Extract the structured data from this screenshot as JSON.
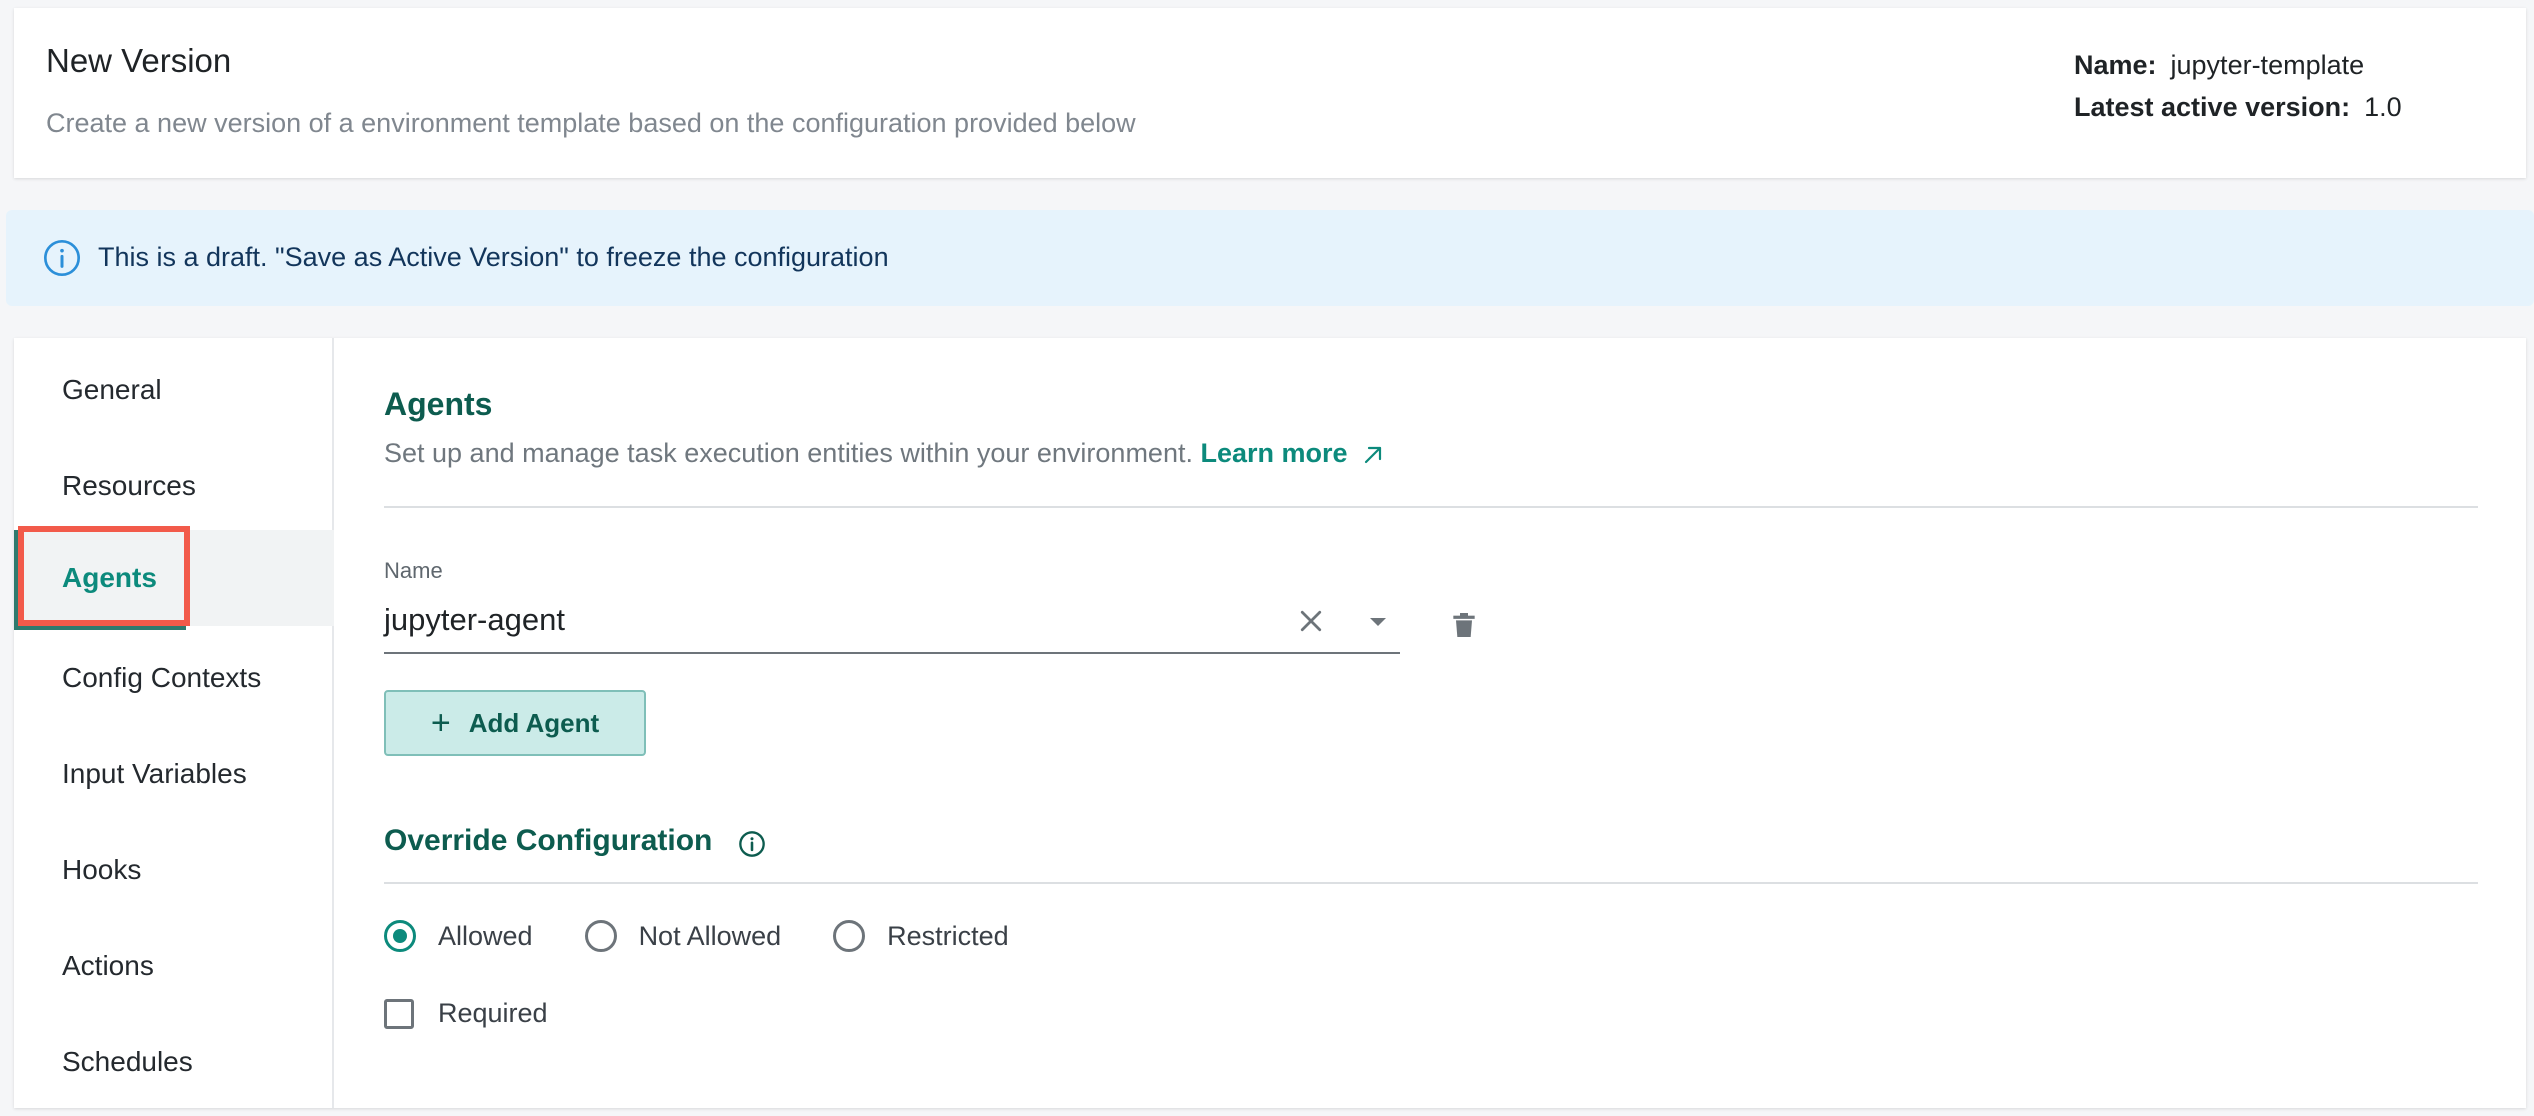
{
  "header": {
    "title": "New Version",
    "subtitle": "Create a new version of a environment template based on the configuration provided below",
    "meta": {
      "name_label": "Name:",
      "name_value": "jupyter-template",
      "version_label": "Latest active version:",
      "version_value": "1.0"
    }
  },
  "banner": {
    "icon": "info-icon",
    "text": "This is a draft. \"Save as Active Version\" to freeze the configuration"
  },
  "sidebar": {
    "items": [
      {
        "label": "General"
      },
      {
        "label": "Resources"
      },
      {
        "label": "Agents"
      },
      {
        "label": "Config Contexts"
      },
      {
        "label": "Input Variables"
      },
      {
        "label": "Hooks"
      },
      {
        "label": "Actions"
      },
      {
        "label": "Schedules"
      }
    ],
    "active": "Agents"
  },
  "agents": {
    "title": "Agents",
    "description": "Set up and manage task execution entities within your environment.",
    "learn_more": "Learn more",
    "name_label": "Name",
    "name_value": "jupyter-agent",
    "add_button": "Add Agent"
  },
  "override": {
    "title": "Override Configuration",
    "options": [
      {
        "label": "Allowed",
        "checked": true
      },
      {
        "label": "Not Allowed",
        "checked": false
      },
      {
        "label": "Restricted",
        "checked": false
      }
    ],
    "required_label": "Required",
    "required_checked": false
  },
  "colors": {
    "accent": "#0c8a7c",
    "heading": "#0d5c4f",
    "banner_bg": "#e6f3fc",
    "highlight": "#f25a4a"
  }
}
